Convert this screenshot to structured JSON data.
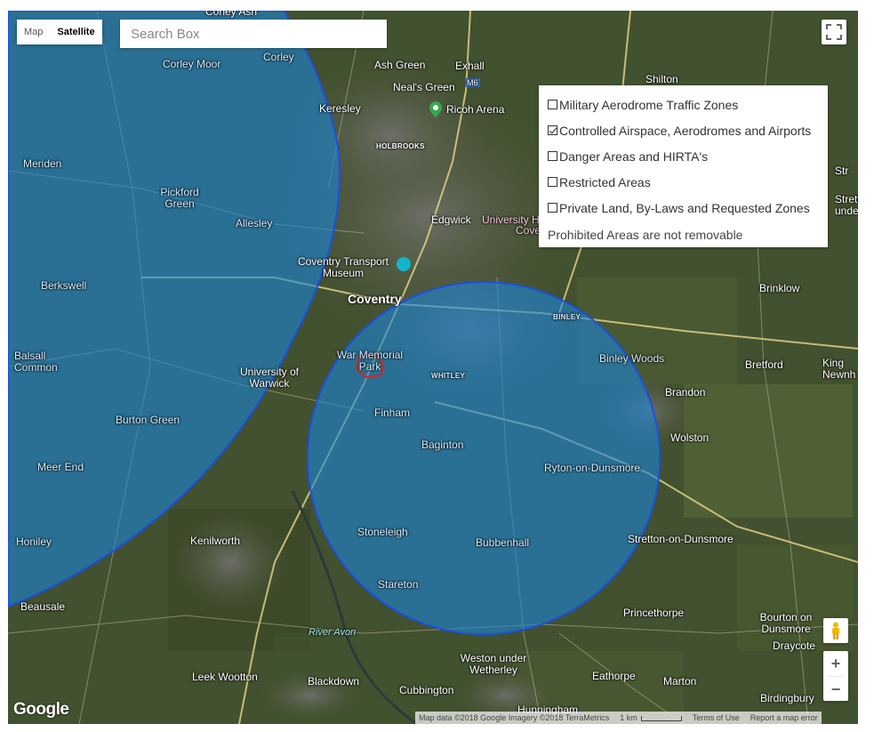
{
  "map_type": {
    "map_label": "Map",
    "satellite_label": "Satellite",
    "active": "Satellite"
  },
  "search": {
    "placeholder": "Search Box"
  },
  "layers": {
    "items": [
      {
        "label": "Military Aerodrome Traffic Zones",
        "checked": false
      },
      {
        "label": "Controlled Airspace, Aerodromes and Airports",
        "checked": true
      },
      {
        "label": "Danger Areas and HIRTA's",
        "checked": false
      },
      {
        "label": "Restricted Areas",
        "checked": false
      },
      {
        "label": "Private Land, By-Laws and Requested Zones",
        "checked": false
      }
    ],
    "note": "Prohibited Areas are not removable"
  },
  "places": {
    "corley_ash": "Corley Ash",
    "corley": "Corley",
    "corley_moor": "Corley Moor",
    "ash_green": "Ash Green",
    "exhall": "Exhall",
    "shilton": "Shilton",
    "neals_green": "Neal's Green",
    "m6": "M6",
    "ricoh_arena": "Ricoh Arena",
    "keresley": "Keresley",
    "holbrooks": "HOLBROOKS",
    "meriden": "Meriden",
    "pickford_green": "Pickford Green",
    "allesley": "Allesley",
    "edgwick": "Edgwick",
    "university_h": "University H",
    "cove": "Cove",
    "coventry_transport_museum": "Coventry Transport Museum",
    "coventry": "Coventry",
    "berkswell": "Berkswell",
    "binley": "BINLEY",
    "brinklow": "Brinklow",
    "balsall_common": "Balsall Common",
    "university_of_warwick": "University of Warwick",
    "war_memorial_park": "War Memorial Park",
    "whitley": "WHITLEY",
    "binley_woods": "Binley Woods",
    "bretford": "Bretford",
    "king_newnh": "King Newnh",
    "brandon": "Brandon",
    "burton_green": "Burton Green",
    "finham": "Finham",
    "baginton": "Baginton",
    "wolston": "Wolston",
    "meer_end": "Meer End",
    "ryton_on_dunsmore": "Ryton-on-Dunsmore",
    "honiley": "Honiley",
    "kenilworth": "Kenilworth",
    "stoneleigh": "Stoneleigh",
    "bubbenhall": "Bubbenhall",
    "stretton_on_dunsmore": "Stretton-on-Dunsmore",
    "stareton": "Stareton",
    "beausale": "Beausale",
    "princethorpe": "Princethorpe",
    "bourton_on_dunsmore": "Bourton on Dunsmore",
    "draycote": "Draycote",
    "river_avon": "River Avon",
    "weston_under_wetherley": "Weston under Wetherley",
    "leek_wootton": "Leek Wootton",
    "blackdown": "Blackdown",
    "cubbington": "Cubbington",
    "eathorpe": "Eathorpe",
    "marton": "Marton",
    "birdingbury": "Birdingbury",
    "hunningham": "Hunningham",
    "stretton_under_fosse": "Stretton under Fo",
    "str": "Str"
  },
  "zoom": {
    "in": "+",
    "out": "−"
  },
  "logo": "Google",
  "attribution": {
    "map_data": "Map data ©2018 Google Imagery ©2018 TerraMetrics",
    "scale": "1 km",
    "terms": "Terms of Use",
    "report": "Report a map error"
  },
  "colors": {
    "zone_fill": "#1a86d8",
    "zone_stroke": "#1c4fe0",
    "park_outline": "#e02020"
  },
  "icons": {
    "fullscreen": "fullscreen-icon",
    "pegman": "pegman-icon",
    "stadium": "stadium-icon",
    "museum": "museum-icon"
  }
}
